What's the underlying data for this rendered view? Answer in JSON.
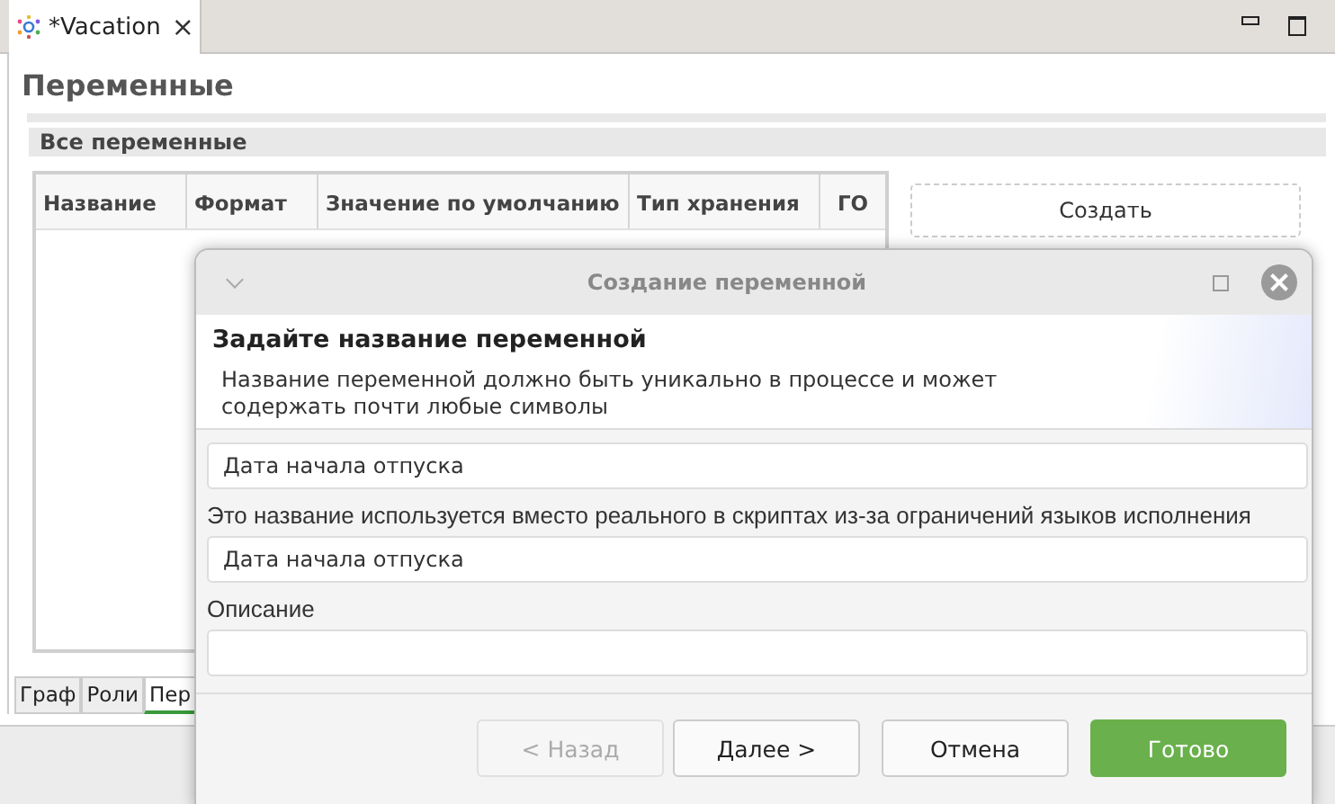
{
  "editor_tab": {
    "title": "*Vacation",
    "close": "×"
  },
  "page": {
    "title": "Переменные",
    "section": "Все переменные"
  },
  "table": {
    "columns": [
      "Название",
      "Формат",
      "Значение по умолчанию",
      "Тип хранения",
      "ГО"
    ]
  },
  "side_buttons": [
    "Создать"
  ],
  "bottom_tabs": [
    {
      "label": "Граф",
      "selected": false
    },
    {
      "label": "Роли",
      "selected": false
    },
    {
      "label": "Пер",
      "selected": true
    }
  ],
  "dialog": {
    "title": "Создание переменной",
    "heading": "Задайте название переменной",
    "description": "Название переменной должно быть уникально в процессе и может содержать почти любые символы",
    "fields": [
      {
        "value": "Дата начала отпуска"
      },
      {
        "label": "Это название используется вместо реального в скриптах из-за ограничений языков исполнения",
        "value": "Дата начала отпуска"
      },
      {
        "label": "Описание"
      }
    ],
    "buttons": [
      {
        "label": "< Назад",
        "kind": "normal",
        "disabled": true
      },
      {
        "label": "Далее >",
        "kind": "normal",
        "disabled": false
      },
      {
        "label": "Отмена",
        "kind": "normal",
        "disabled": false
      },
      {
        "label": "Готово",
        "kind": "primary",
        "disabled": false
      }
    ]
  }
}
